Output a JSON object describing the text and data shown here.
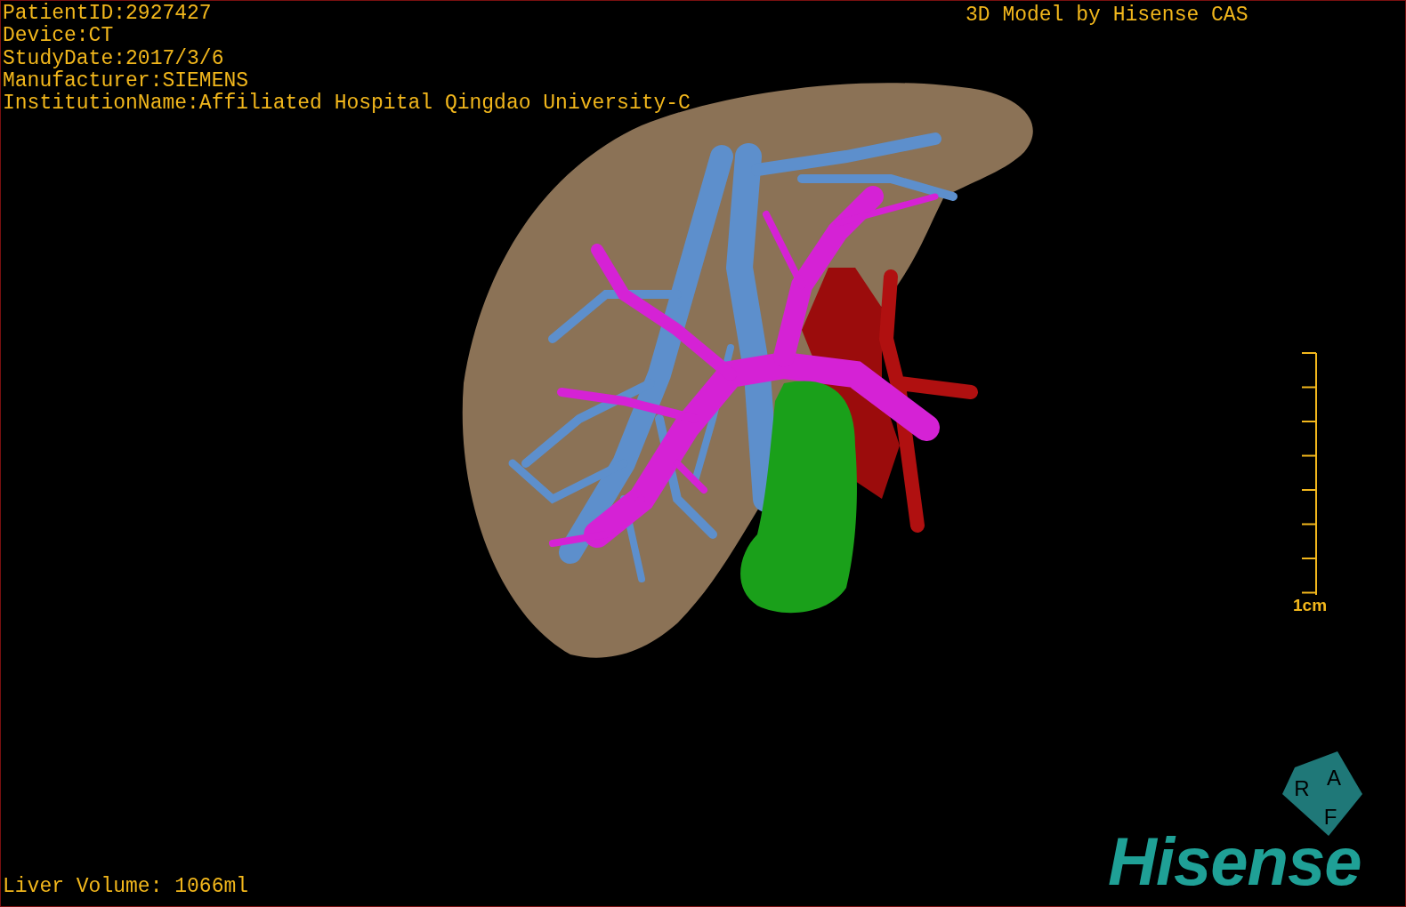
{
  "header_info": [
    "PatientID:2927427",
    "Device:CT",
    "StudyDate:2017/3/6",
    "Manufacturer:SIEMENS",
    "InstitutionName:Affiliated Hospital Qingdao University-C"
  ],
  "title": "3D Model by Hisense CAS",
  "scale_bar": {
    "label": "1cm"
  },
  "liver_volume": "Liver Volume: 1066ml",
  "orientation_cube": {
    "labels": [
      "R",
      "A",
      "F"
    ]
  },
  "logo": "Hisense"
}
